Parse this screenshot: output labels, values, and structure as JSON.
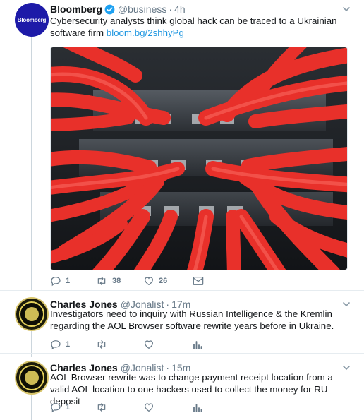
{
  "tweets": [
    {
      "name": "Bloomberg",
      "handle": "@business",
      "time": "4h",
      "avatar_label": "Bloomberg",
      "text": "Cybersecurity analysts think global hack can be traced to a Ukrainian software firm ",
      "link": "bloom.bg/2shhyPg",
      "replies": "1",
      "retweets": "38",
      "likes": "26"
    },
    {
      "name": "Charles Jones",
      "handle": "@Jonalist",
      "time": "17m",
      "text": "Investigators need to inquiry with Russian Intelligence & the Kremlin regarding the AOL Browser software rewrite years before in Ukraine.",
      "replies": "1"
    },
    {
      "name": "Charles Jones",
      "handle": "@Jonalist",
      "time": "15m",
      "text": "AOL Browser rewrite was to change payment receipt location from a valid AOL location to one hackers used to collect the money for RU deposit",
      "replies": "1"
    }
  ],
  "colors": {
    "link": "#1b95e0",
    "secondary_text": "#657786",
    "verified": "#1da1f2",
    "thread_line": "#ccd6dd",
    "bloomberg_avatar": "#1d1aa8",
    "cable_red": "#e8302a"
  },
  "icons": [
    "chevron-down-icon",
    "verified-badge-icon",
    "reply-icon",
    "retweet-icon",
    "like-icon",
    "analytics-icon"
  ]
}
